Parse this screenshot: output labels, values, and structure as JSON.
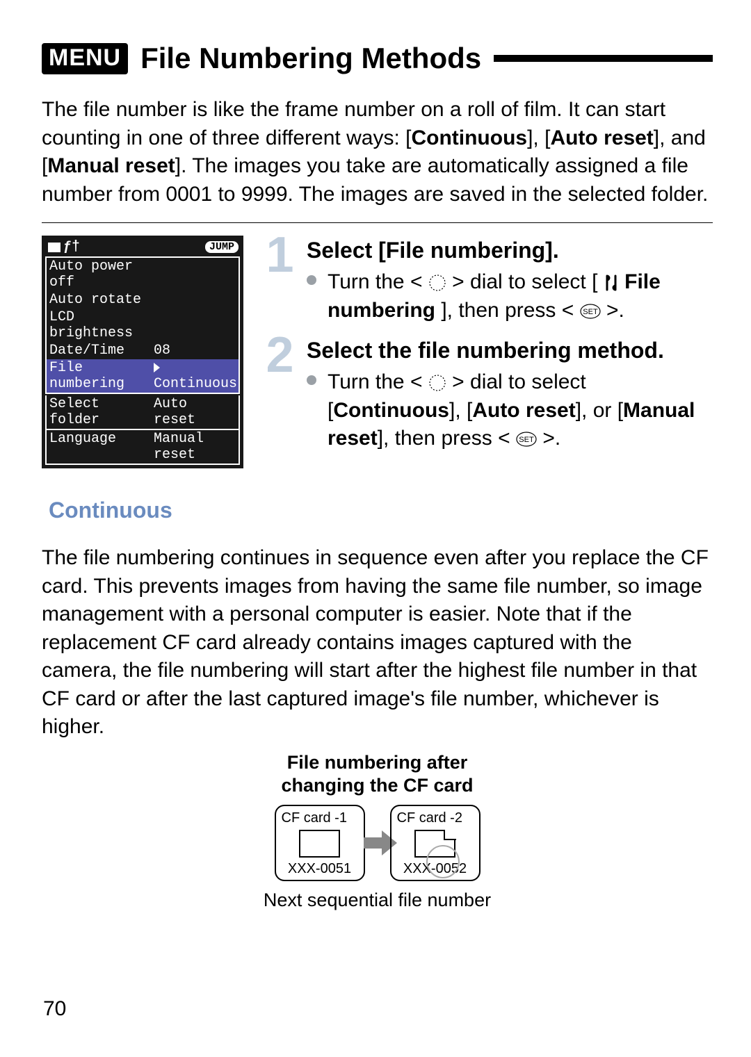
{
  "title": {
    "menu_badge": "MENU",
    "text": "File Numbering Methods"
  },
  "intro": {
    "pre": "The file number is like the frame number on a roll of film. It can start counting in one of three different ways: [",
    "opt1": "Continuous",
    "mid1": "], [",
    "opt2": "Auto reset",
    "mid2": "], and [",
    "opt3": "Manual reset",
    "post": "]. The images you take are automatically assigned a file number from 0001 to 9999. The images are saved in the selected folder."
  },
  "menu": {
    "top_icon_text": "ƒ†",
    "jump": "JUMP",
    "rows": [
      {
        "k": "Auto power off",
        "v": ""
      },
      {
        "k": "Auto rotate",
        "v": ""
      },
      {
        "k": "LCD brightness",
        "v": ""
      },
      {
        "k": "Date/Time",
        "v": "08"
      },
      {
        "k": "File numbering",
        "v": "Continuous",
        "sel": true
      },
      {
        "k": "Select folder",
        "v": "Auto reset"
      },
      {
        "k": "Language",
        "v": "Manual reset"
      }
    ]
  },
  "steps": [
    {
      "num": "1",
      "head": "Select [File numbering].",
      "line_pre": "Turn the <",
      "line_mid": "> dial to select [",
      "bold_inline": "File numbering",
      "line_mid2": "], then press <",
      "line_end": ">."
    },
    {
      "num": "2",
      "head": "Select the file numbering method.",
      "line_pre": "Turn the <",
      "line_mid": "> dial to select [",
      "b1": "Continuous",
      "mid_a": "], [",
      "b2": "Auto reset",
      "mid_b": "], or [",
      "b3": "Manual reset",
      "line_mid2": "], then press <",
      "line_end": ">."
    }
  ],
  "subhead": "Continuous",
  "continuous_body": "The file numbering continues in sequence even after you replace the CF card. This prevents images from having the same file number, so image management with a personal computer is easier. Note that if the replacement CF card already contains images captured with the camera, the file numbering will start after the highest file number in that CF card or after the last captured image's file number, whichever is higher.",
  "diagram": {
    "title_l1": "File numbering after",
    "title_l2": "changing the CF card",
    "card1_label": "CF card -1",
    "card1_file": "XXX-0051",
    "card2_label": "CF card -2",
    "card2_file": "XXX-0052",
    "caption": "Next sequential file number"
  },
  "page_number": "70"
}
